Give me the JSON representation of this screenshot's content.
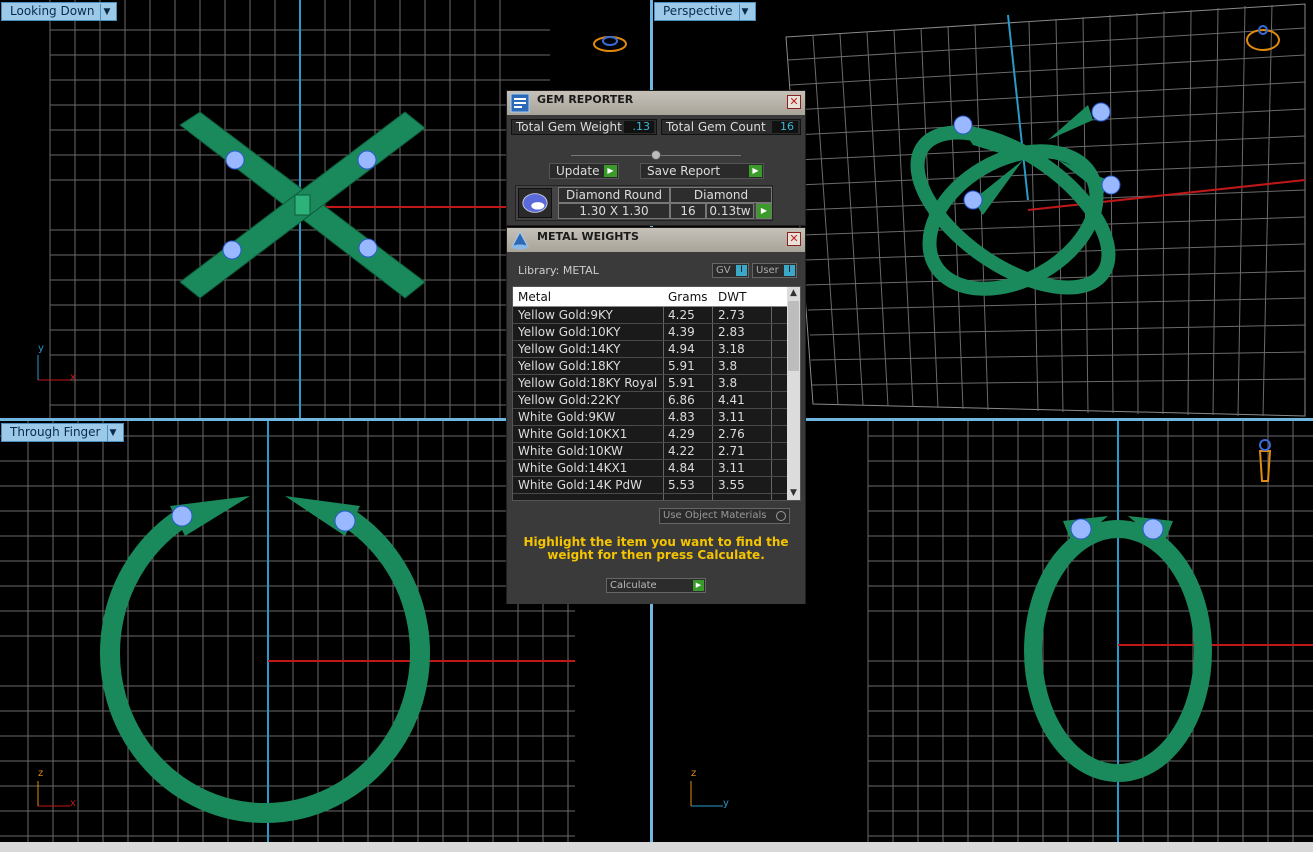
{
  "viewports": {
    "top_left": {
      "label": "Looking Down",
      "axes": {
        "v": "y",
        "h": "x"
      }
    },
    "top_right": {
      "label": "Perspective"
    },
    "bottom_left": {
      "label": "Through Finger",
      "axes": {
        "v": "z",
        "h": "x"
      }
    },
    "bottom_right": {
      "label": "",
      "axes": {
        "v": "z",
        "h": "y"
      }
    }
  },
  "gem_reporter": {
    "title": "GEM REPORTER",
    "total_weight_label": "Total Gem Weight",
    "total_weight_value": ".13",
    "total_count_label": "Total Gem Count",
    "total_count_value": "16",
    "update_label": "Update",
    "save_report_label": "Save Report",
    "gem": {
      "shape": "Diamond Round",
      "type": "Diamond",
      "size": "1.30 X 1.30",
      "count": "16",
      "weight": "0.13tw"
    }
  },
  "metal_weights": {
    "title": "METAL WEIGHTS",
    "library_label": "Library: METAL",
    "gv_label": "GV",
    "user_label": "User",
    "columns": [
      "Metal",
      "Grams",
      "DWT"
    ],
    "rows": [
      [
        "Yellow Gold:9KY",
        "4.25",
        "2.73"
      ],
      [
        "Yellow Gold:10KY",
        "4.39",
        "2.83"
      ],
      [
        "Yellow Gold:14KY",
        "4.94",
        "3.18"
      ],
      [
        "Yellow Gold:18KY",
        "5.91",
        "3.8"
      ],
      [
        "Yellow Gold:18KY Royal",
        "5.91",
        "3.8"
      ],
      [
        "Yellow Gold:22KY",
        "6.86",
        "4.41"
      ],
      [
        "White Gold:9KW",
        "4.83",
        "3.11"
      ],
      [
        "White Gold:10KX1",
        "4.29",
        "2.76"
      ],
      [
        "White Gold:10KW",
        "4.22",
        "2.71"
      ],
      [
        "White Gold:14KX1",
        "4.84",
        "3.11"
      ],
      [
        "White Gold:14K PdW",
        "5.53",
        "3.55"
      ]
    ],
    "use_object_materials_label": "Use Object Materials",
    "hint": "Highlight the item you want to find the weight for then press Calculate.",
    "calculate_label": "Calculate"
  },
  "colors": {
    "grid": "#8a8a8a",
    "ring": "#1a8a5c",
    "gem": "#9ab8ff",
    "axis_red": "#c01818",
    "axis_blue": "#2a9ac8",
    "hint": "#f5c400"
  }
}
